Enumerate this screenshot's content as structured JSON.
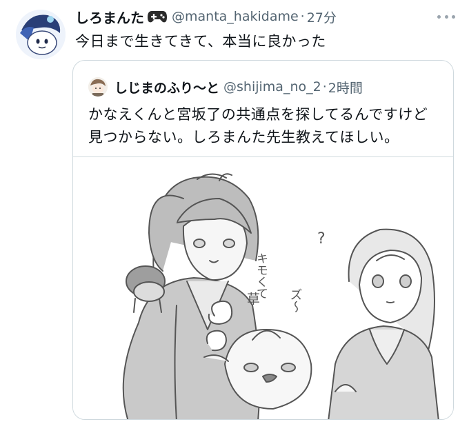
{
  "tweet": {
    "display_name": "しろまんた",
    "handle": "@manta_hakidame",
    "separator": "·",
    "time": "27分",
    "text": "今日まで生きてきて、本当に良かった"
  },
  "quoted_tweet": {
    "display_name": "しじまのふり〜と",
    "handle": "@shijima_no_2",
    "separator": "·",
    "time": "2時間",
    "text_lines": [
      "かなえくんと宮坂了の共通点を探してるんですけど",
      "見つからない。しろまんた先生教えてほしい。"
    ],
    "image_sfx": {
      "kimokute": "キモくて",
      "kusa": "草",
      "zudo": "ズ〜",
      "question": "?"
    }
  },
  "icons": {
    "avatar": "character-avatar",
    "gamepad": "gamepad-icon",
    "more": "more-icon"
  },
  "colors": {
    "text": "#0f1419",
    "secondary": "#536471",
    "border": "#cfd9de"
  }
}
